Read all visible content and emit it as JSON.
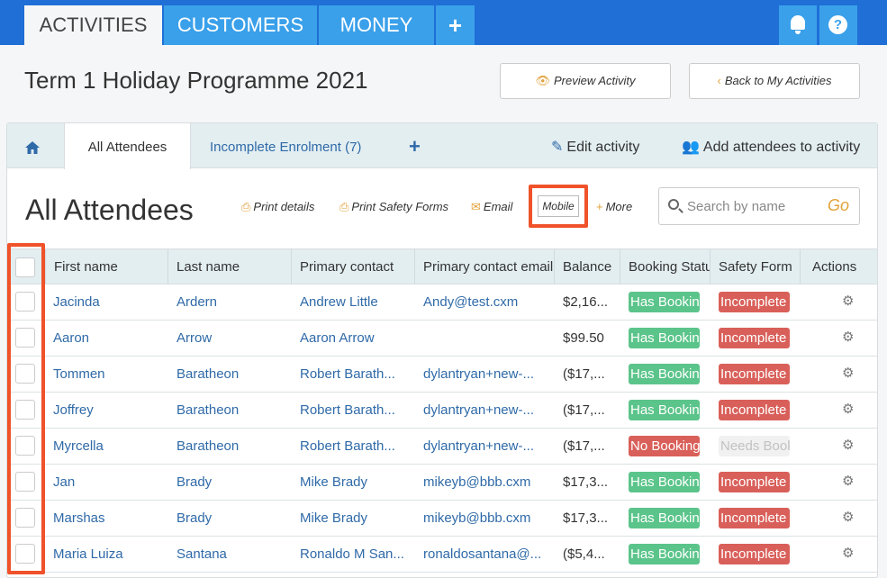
{
  "topnav": {
    "tabs": [
      {
        "label": "ACTIVITIES",
        "active": true
      },
      {
        "label": "CUSTOMERS"
      },
      {
        "label": "MONEY"
      }
    ],
    "add_label": "+",
    "help_label": "?"
  },
  "header": {
    "title": "Term 1 Holiday Programme 2021",
    "preview_label": "Preview Activity",
    "back_label": "Back to My Activities"
  },
  "subtabs": {
    "all_attendees": "All Attendees",
    "incomplete": "Incomplete Enrolment (7)",
    "add": "+",
    "edit": "Edit activity",
    "add_attendees": "Add attendees to activity"
  },
  "toolbar": {
    "title": "All Attendees",
    "print_details": "Print details",
    "print_safety": "Print Safety Forms",
    "email": "Email",
    "mobile": "Mobile",
    "more": "More",
    "search_placeholder": "Search by name",
    "go": "Go"
  },
  "table": {
    "headers": [
      "First name",
      "Last name",
      "Primary contact",
      "Primary contact email",
      "Balance",
      "Booking Status",
      "Safety Form",
      "Actions"
    ],
    "rows": [
      {
        "first": "Jacinda",
        "last": "Ardern",
        "contact": "Andrew Little",
        "email": "Andy@test.cxm",
        "balance": "$2,16...",
        "booking": "Has Booking",
        "safety": "Incomplete"
      },
      {
        "first": "Aaron",
        "last": "Arrow",
        "contact": "Aaron Arrow",
        "email": "",
        "balance": "$99.50",
        "booking": "Has Booking",
        "safety": "Incomplete"
      },
      {
        "first": "Tommen",
        "last": "Baratheon",
        "contact": "Robert Barath...",
        "email": "dylantryan+new-...",
        "balance": "($17,...",
        "booking": "Has Booking",
        "safety": "Incomplete"
      },
      {
        "first": "Joffrey",
        "last": "Baratheon",
        "contact": "Robert Barath...",
        "email": "dylantryan+new-...",
        "balance": "($17,...",
        "booking": "Has Booking",
        "safety": "Incomplete"
      },
      {
        "first": "Myrcella",
        "last": "Baratheon",
        "contact": "Robert Barath...",
        "email": "dylantryan+new-...",
        "balance": "($17,...",
        "booking": "No Booking",
        "safety": "Needs Booking"
      },
      {
        "first": "Jan",
        "last": "Brady",
        "contact": "Mike Brady",
        "email": "mikeyb@bbb.cxm",
        "balance": "$17,3...",
        "booking": "Has Booking",
        "safety": "Incomplete"
      },
      {
        "first": "Marshas",
        "last": "Brady",
        "contact": "Mike Brady",
        "email": "mikeyb@bbb.cxm",
        "balance": "$17,3...",
        "booking": "Has Booking",
        "safety": "Incomplete"
      },
      {
        "first": "Maria Luiza",
        "last": "Santana",
        "contact": "Ronaldo M San...",
        "email": "ronaldosantana@...",
        "balance": "($5,4...",
        "booking": "Has Booking",
        "safety": "Incomplete"
      }
    ]
  },
  "colors": {
    "nav": "#1f6fd6",
    "tab": "#3aa0ea",
    "link": "#2f6aa8",
    "highlight": "#f0522a",
    "green": "#5bc48a",
    "red": "#d9605a"
  }
}
